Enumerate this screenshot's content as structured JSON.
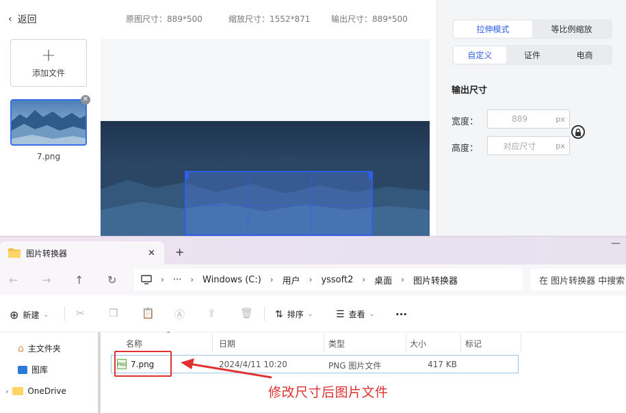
{
  "app": {
    "back_label": "返回",
    "original_size_label": "原图尺寸：889*500",
    "zoom_size_label": "缩放尺寸：1552*871",
    "output_size_label": "输出尺寸：889*500",
    "add_file_label": "添加文件",
    "thumb_name": "7.png",
    "mode_tabs": [
      "拉伸模式",
      "等比例缩放"
    ],
    "preset_tabs": [
      "自定义",
      "证件",
      "电商"
    ],
    "output_title": "输出尺寸",
    "width_label": "宽度：",
    "width_value": "889",
    "height_label": "高度：",
    "height_placeholder": "对应尺寸",
    "unit": "px"
  },
  "explorer": {
    "tab_title": "图片转换器",
    "breadcrumb": [
      "Windows (C:)",
      "用户",
      "yssoft2",
      "桌面",
      "图片转换器"
    ],
    "search_placeholder": "在 图片转换器 中搜索",
    "new_label": "新建",
    "sort_label": "排序",
    "view_label": "查看",
    "more_label": "···",
    "sidebar": [
      "主文件夹",
      "图库",
      "OneDrive"
    ],
    "columns": [
      "名称",
      "日期",
      "类型",
      "大小",
      "标记"
    ],
    "file": {
      "name": "7.png",
      "date": "2024/4/11 10:20",
      "type": "PNG 图片文件",
      "size": "417 KB"
    }
  },
  "annotation": "修改尺寸后图片文件",
  "colors": {
    "accent": "#2f5fe8",
    "annotation_red": "#e03030"
  }
}
